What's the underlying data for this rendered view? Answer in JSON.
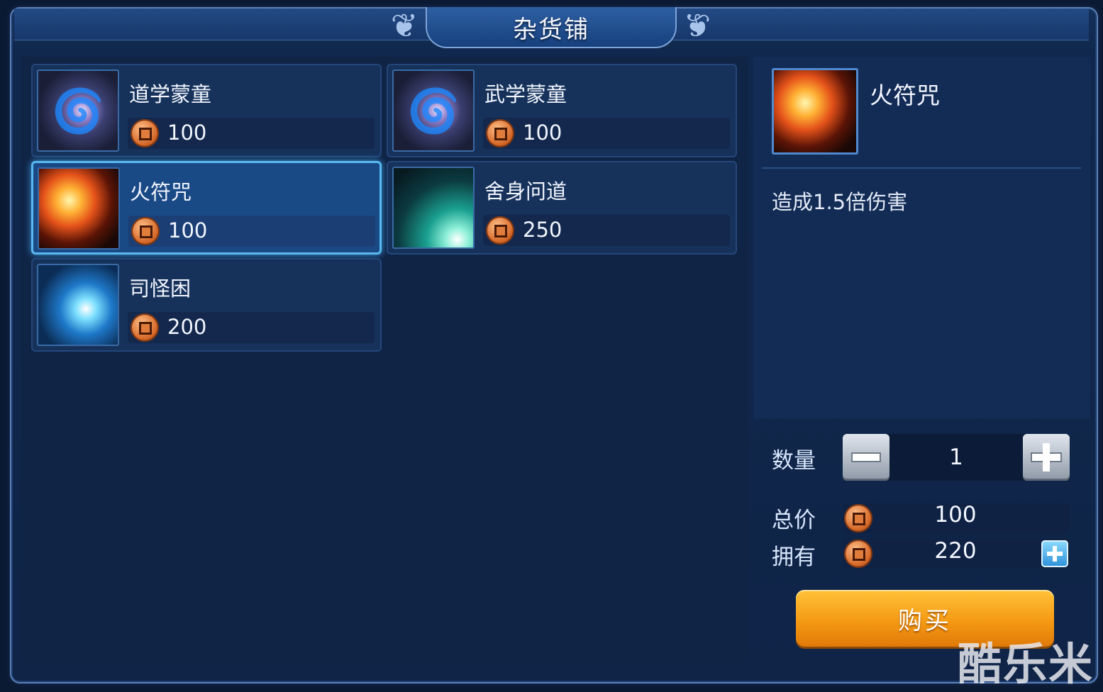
{
  "header": {
    "title": "杂货铺"
  },
  "items": [
    {
      "name": "道学蒙童",
      "price": "100",
      "icon": "swirl-icon"
    },
    {
      "name": "武学蒙童",
      "price": "100",
      "icon": "swirl-icon"
    },
    {
      "name": "火符咒",
      "price": "100",
      "icon": "fire-icon",
      "selected": true
    },
    {
      "name": "舍身问道",
      "price": "250",
      "icon": "green-strike-icon"
    },
    {
      "name": "司怪困",
      "price": "200",
      "icon": "blue-blade-icon"
    }
  ],
  "detail": {
    "name": "火符咒",
    "icon": "fire-icon",
    "description": "造成1.5倍伤害",
    "quantity_label": "数量",
    "quantity": "1",
    "total_label": "总价",
    "total": "100",
    "owned_label": "拥有",
    "owned": "220",
    "buy_label": "购买"
  },
  "watermark": "酷乐米",
  "colors": {
    "accent": "#f59a14",
    "selected_border": "#5ab8f0",
    "panel": "#102446"
  }
}
